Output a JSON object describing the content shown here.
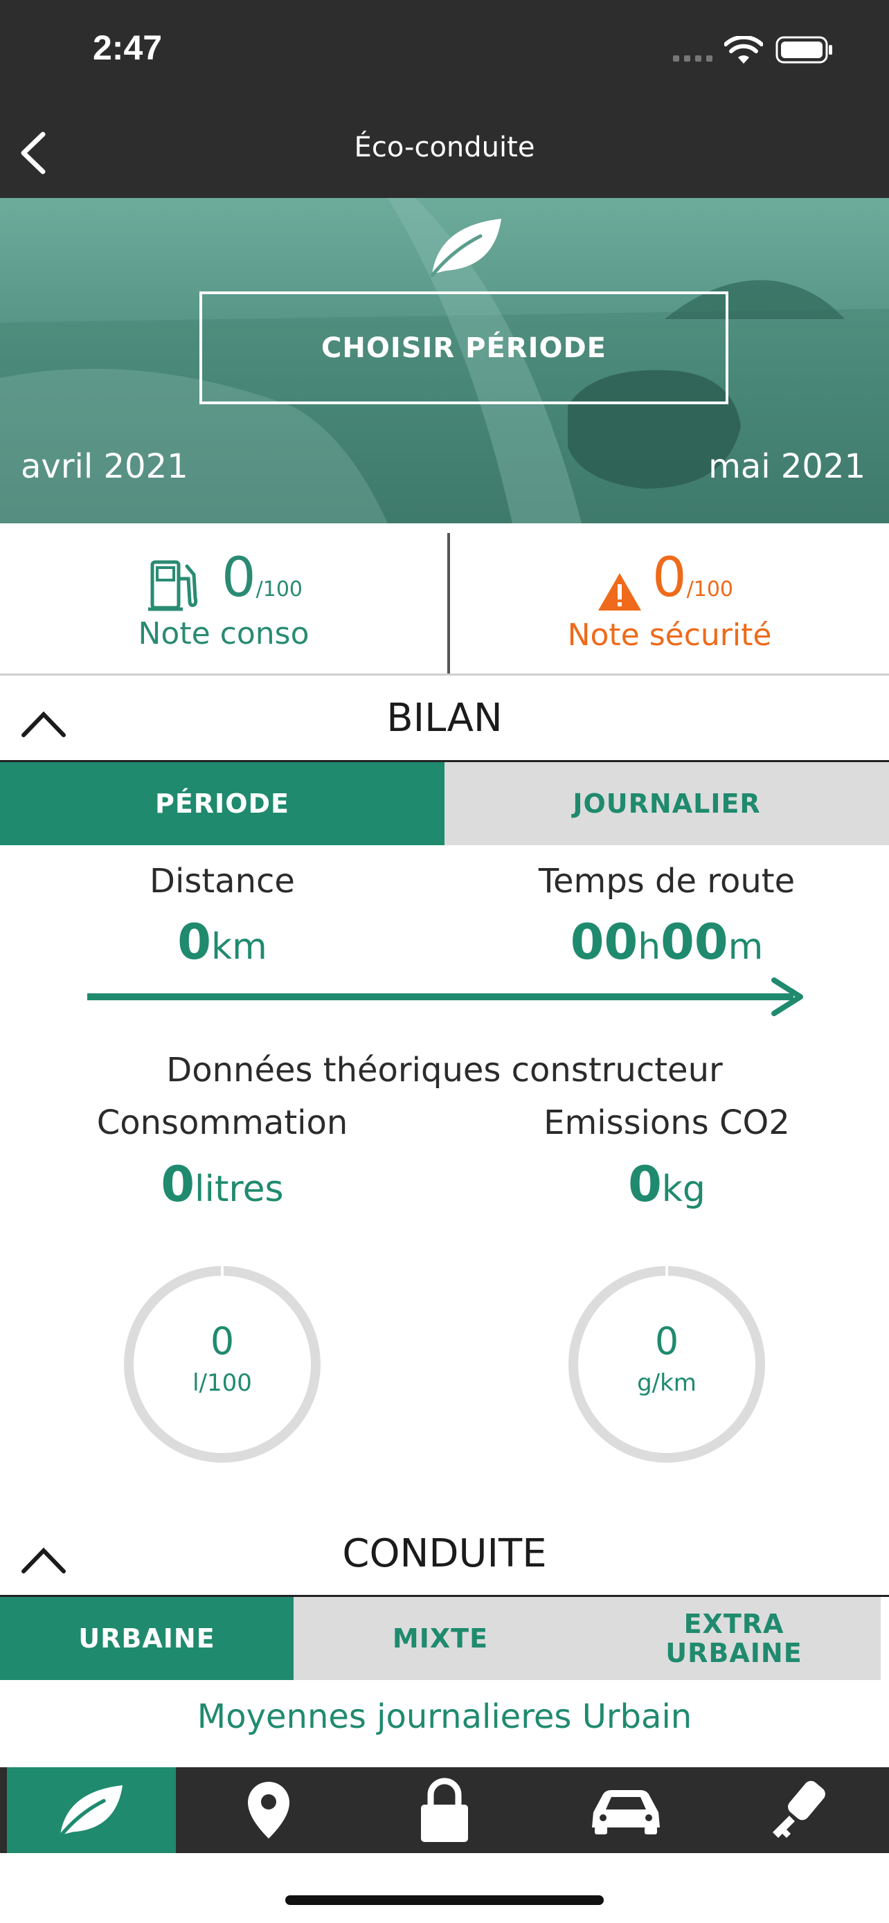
{
  "status_bar": {
    "time": "2:47"
  },
  "nav": {
    "title": "Éco-conduite",
    "back_icon": "chevron-left-icon"
  },
  "hero": {
    "leaf_icon": "leaf-icon",
    "choose_button": "CHOISIR PÉRIODE",
    "start_date": "avril 2021",
    "end_date": "mai 2021"
  },
  "scores": {
    "conso": {
      "icon": "fuel-pump-icon",
      "value": "0",
      "max": "/100",
      "label": "Note conso",
      "color": "#2a8b72"
    },
    "safety": {
      "icon": "warning-icon",
      "value": "0",
      "max": "/100",
      "label": "Note sécurité",
      "color": "#ef6a1a"
    }
  },
  "bilan": {
    "title": "BILAN",
    "tabs": [
      {
        "label": "PÉRIODE",
        "active": true
      },
      {
        "label": "JOURNALIER",
        "active": false
      }
    ],
    "distance": {
      "label": "Distance",
      "value": "0",
      "unit": "km"
    },
    "drive_time": {
      "label": "Temps de route",
      "hours": "00",
      "h_unit": "h",
      "minutes": "00",
      "m_unit": "m"
    },
    "manufacturer_note": "Données théoriques constructeur",
    "consumption": {
      "label": "Consommation",
      "value": "0",
      "unit": "litres"
    },
    "emissions": {
      "label": "Emissions CO2",
      "value": "0",
      "unit": "kg"
    },
    "gauge_conso": {
      "value": "0",
      "unit": "l/100",
      "level": 0
    },
    "gauge_co2": {
      "value": "0",
      "unit": "g/km",
      "level": 0
    }
  },
  "conduite": {
    "title": "CONDUITE",
    "tabs": [
      {
        "label": "URBAINE",
        "active": true
      },
      {
        "label": "MIXTE",
        "active": false
      },
      {
        "label": "EXTRA URBAINE",
        "active": false
      }
    ],
    "subtitle": "Moyennes journalieres Urbain"
  },
  "tab_bar": {
    "items": [
      {
        "icon": "leaf-icon",
        "active": true
      },
      {
        "icon": "location-pin-icon",
        "active": false
      },
      {
        "icon": "lock-icon",
        "active": false
      },
      {
        "icon": "car-icon",
        "active": false
      },
      {
        "icon": "car-key-icon",
        "active": false
      }
    ]
  },
  "colors": {
    "accent": "#1f8a6e",
    "warning": "#ef6a1a",
    "dark_bar": "#2d2d2d",
    "inactive_tab": "#dcdcdc"
  }
}
